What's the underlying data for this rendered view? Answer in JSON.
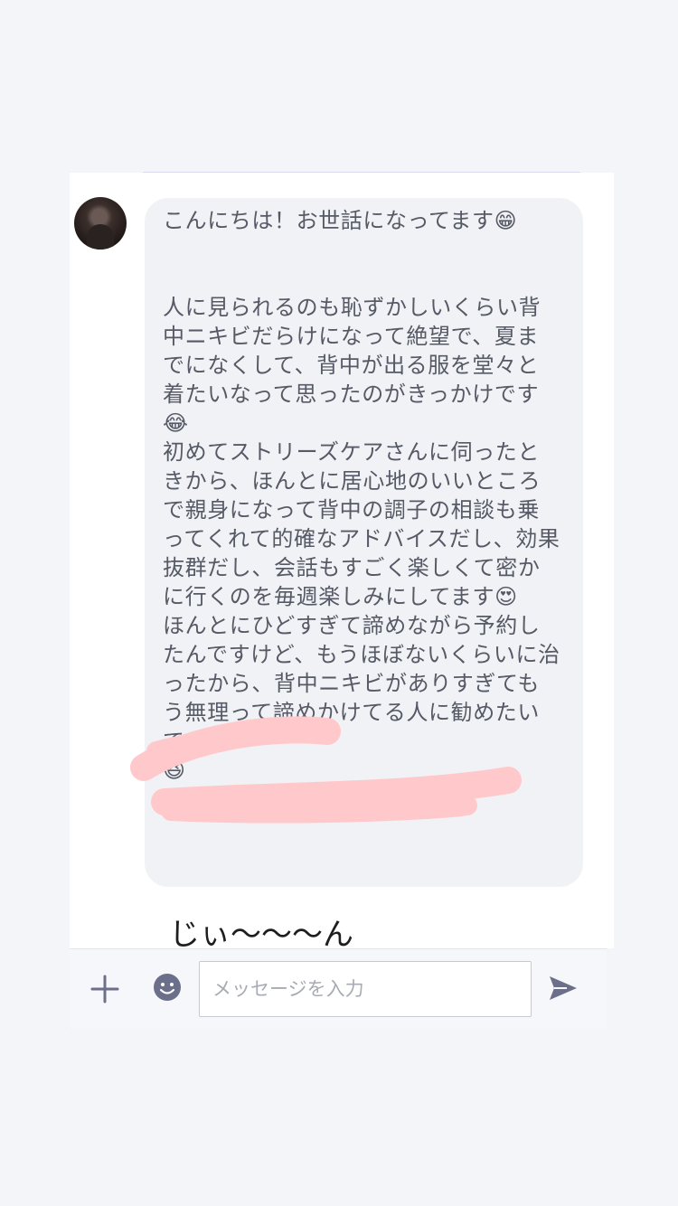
{
  "chat": {
    "message_text": "こんにちは！お世話になってます😁\n\n\n人に見られるのも恥ずかしいくらい背中ニキビだらけになって絶望で、夏までになくして、背中が出る服を堂々と着たいなって思ったのがきっかけです😂\n初めてストリーズケアさんに伺ったときから、ほんとに居心地のいいところで親身になって背中の調子の相談も乗ってくれて的確なアドバイスだし、効果抜群だし、会話もすごく楽しくて密かに行くのを毎週楽しみにしてます😍\nほんとにひどすぎて諦めながら予約したんですけど、もうほぼないくらいに治ったから、背中ニキビがありすぎてもう無理って諦めかけてる人に勧めたいです😆\n😆",
    "handwritten_note": "じぃ〜〜〜ん"
  },
  "input_bar": {
    "placeholder": "メッセージを入力"
  },
  "icons": {
    "plus": "plus-icon",
    "emoji": "smiley-icon",
    "send": "send-icon"
  },
  "colors": {
    "background": "#f4f5f8",
    "bubble": "#f1f2f5",
    "text": "#555a66",
    "icon": "#6b6f8a",
    "redaction": "#ffc9cc"
  }
}
